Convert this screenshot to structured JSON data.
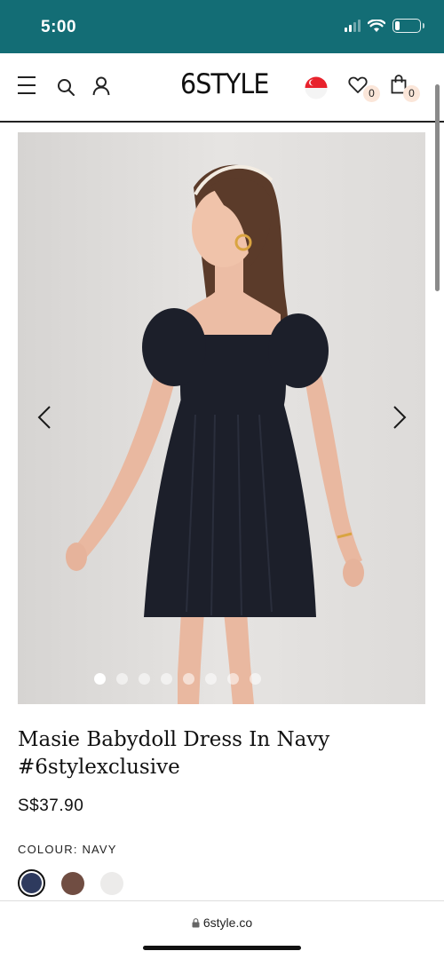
{
  "status_bar": {
    "time": "5:00",
    "battery_level": 0.2
  },
  "header": {
    "logo": "6STYLE",
    "wishlist_count": "0",
    "cart_count": "0",
    "icons": [
      "menu-icon",
      "search-icon",
      "account-icon",
      "singapore-flag-icon",
      "heart-icon",
      "shopping-bag-icon"
    ]
  },
  "gallery": {
    "image_count": 8,
    "active_index": 0,
    "icons": [
      "chevron-left-icon",
      "chevron-right-icon"
    ]
  },
  "product": {
    "title_line1": "Masie Babydoll Dress In Navy",
    "title_line2": "#6stylexclusive",
    "price": "S$37.90",
    "colour_label": "COLOUR: NAVY",
    "swatches": [
      {
        "name": "navy",
        "color": "#2e3a5e",
        "selected": true
      },
      {
        "name": "brown",
        "color": "#704d42",
        "selected": false
      },
      {
        "name": "white",
        "color": "#ecebea",
        "selected": false
      }
    ]
  },
  "browser": {
    "url": "6style.co"
  },
  "colors": {
    "status_bar": "#136d75",
    "badge": "#fbe6d9",
    "dress": "#1c1f2a"
  }
}
